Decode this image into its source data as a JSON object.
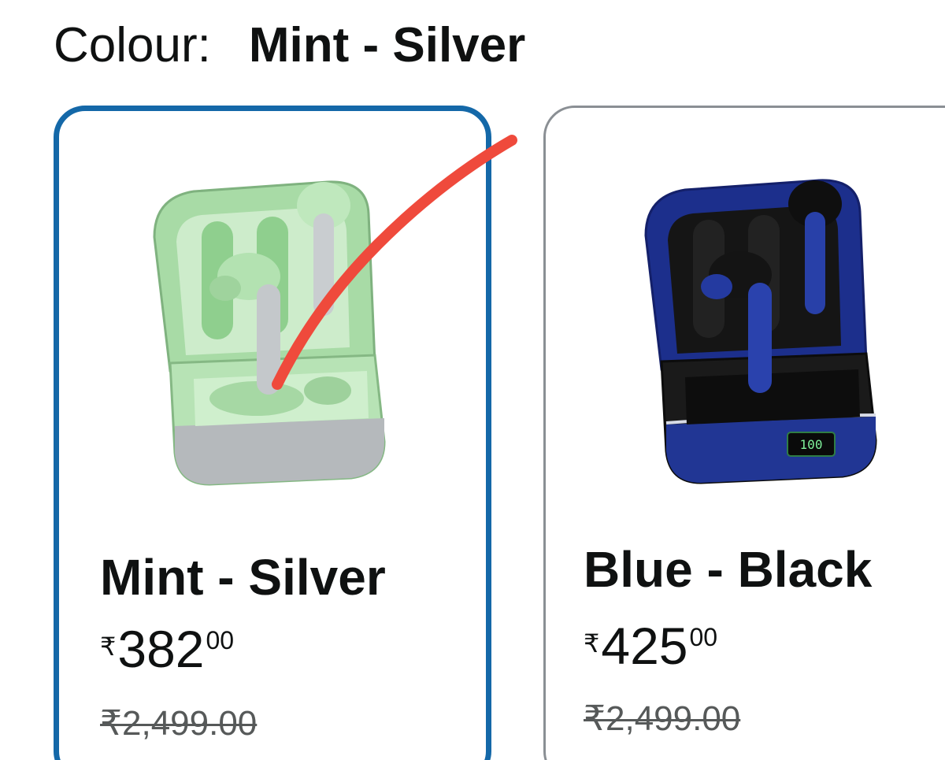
{
  "colour": {
    "label": "Colour:",
    "selected_value": "Mint - Silver"
  },
  "variants": [
    {
      "name": "Mint - Silver",
      "currency": "₹",
      "price_whole": "382",
      "price_fraction": "00",
      "mrp": "₹2,499.00",
      "selected": true,
      "image_icon": "mint-earbuds-case-image",
      "colors": {
        "body": "#9fd8a0",
        "accent": "#b9bcbf"
      }
    },
    {
      "name": "Blue - Black",
      "currency": "₹",
      "price_whole": "425",
      "price_fraction": "00",
      "mrp": "₹2,499.00",
      "selected": false,
      "image_icon": "blue-black-earbuds-case-image",
      "colors": {
        "body": "#1b2e8a",
        "accent": "#111111"
      }
    }
  ],
  "colors": {
    "selected_border": "#1468a8",
    "unselected_border": "#8a8f94",
    "annotation": "#ef4a3c"
  }
}
